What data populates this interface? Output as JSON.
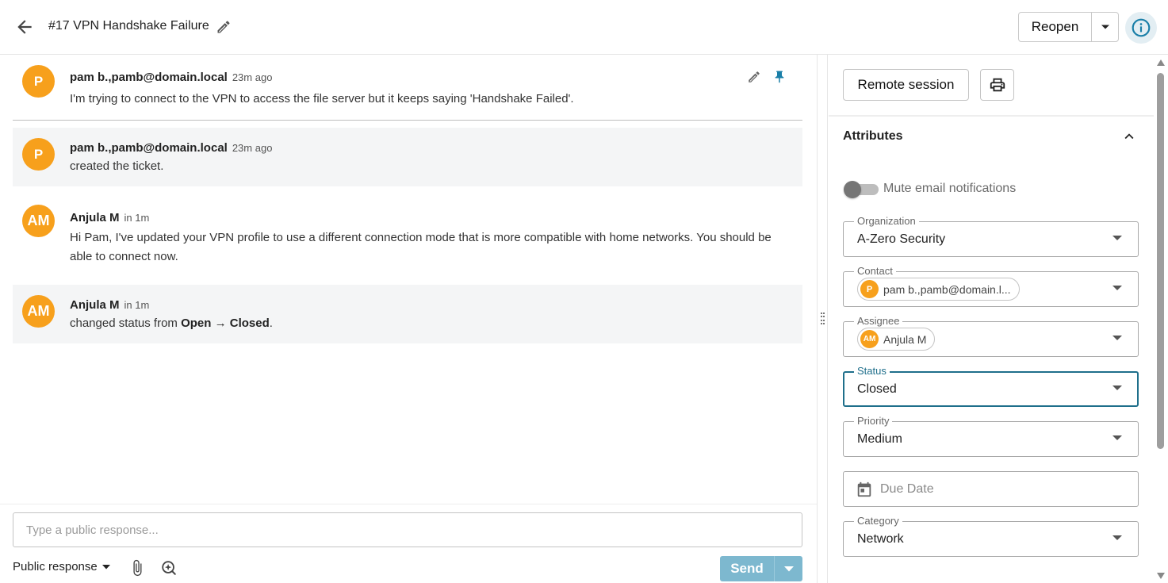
{
  "header": {
    "title": "#17 VPN Handshake Failure",
    "reopen_label": "Reopen"
  },
  "messages": [
    {
      "avatar": "P",
      "author": "pam b.,pamb@domain.local",
      "time": "23m ago",
      "body": "I'm trying to connect to the VPN to access the file server but it keeps saying 'Handshake Failed'."
    },
    {
      "avatar": "P",
      "author": "pam b.,pamb@domain.local",
      "time": "23m ago",
      "body": "created the ticket."
    },
    {
      "avatar": "AM",
      "author": "Anjula M",
      "time": "in 1m",
      "body": "Hi Pam, I've updated your VPN profile to use a different connection mode that is more compatible with home networks. You should be able to connect now."
    },
    {
      "avatar": "AM",
      "author": "Anjula M",
      "time": "in 1m",
      "body_prefix": "changed status from ",
      "status_from": "Open",
      "arrow": " → ",
      "status_to": "Closed",
      "body_suffix": "."
    }
  ],
  "composer": {
    "placeholder": "Type a public response...",
    "response_type": "Public response",
    "send_label": "Send"
  },
  "side": {
    "remote_session_label": "Remote session",
    "attributes_title": "Attributes",
    "mute_label": "Mute email notifications",
    "fields": {
      "organization": {
        "label": "Organization",
        "value": "A-Zero Security"
      },
      "contact": {
        "label": "Contact",
        "avatar": "P",
        "value": "pam b.,pamb@domain.l..."
      },
      "assignee": {
        "label": "Assignee",
        "avatar": "AM",
        "value": "Anjula M"
      },
      "status": {
        "label": "Status",
        "value": "Closed"
      },
      "priority": {
        "label": "Priority",
        "value": "Medium"
      },
      "due_date": {
        "placeholder": "Due Date"
      },
      "category": {
        "label": "Category",
        "value": "Network"
      }
    }
  },
  "colors": {
    "avatar_orange": "#f7a01c",
    "accent_teal": "#1f6f8b",
    "pin_blue": "#1a7fa8",
    "send_disabled": "#7db8cf",
    "info_bg": "#e3eef3"
  },
  "icons": [
    "back-arrow-icon",
    "pencil-icon",
    "chevron-down-icon",
    "info-icon",
    "pin-icon",
    "printer-icon",
    "chevron-up-icon",
    "paperclip-icon",
    "ai-sparkle-icon",
    "calendar-icon"
  ]
}
